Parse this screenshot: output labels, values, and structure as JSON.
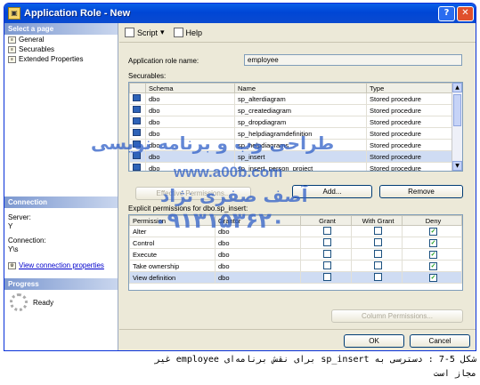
{
  "window": {
    "title": "Application Role - New"
  },
  "left": {
    "select_page_header": "Select a page",
    "pages": [
      {
        "label": "General"
      },
      {
        "label": "Securables"
      },
      {
        "label": "Extended Properties"
      }
    ],
    "connection_header": "Connection",
    "server_label": "Server:",
    "server_value": "Y",
    "connection_label": "Connection:",
    "connection_value": "Y\\s",
    "view_conn_link": "View connection properties",
    "progress_header": "Progress",
    "progress_status": "Ready"
  },
  "toolbar": {
    "script_label": "Script",
    "help_label": "Help"
  },
  "form": {
    "role_name_label": "Application role name:",
    "role_name_value": "employee",
    "securables_label": "Securables:",
    "securables_columns": [
      "",
      "Schema",
      "Name",
      "Type"
    ],
    "securables_rows": [
      {
        "schema": "dbo",
        "name": "sp_alterdiagram",
        "type": "Stored procedure"
      },
      {
        "schema": "dbo",
        "name": "sp_creatediagram",
        "type": "Stored procedure"
      },
      {
        "schema": "dbo",
        "name": "sp_dropdiagram",
        "type": "Stored procedure"
      },
      {
        "schema": "dbo",
        "name": "sp_helpdiagramdefinition",
        "type": "Stored procedure"
      },
      {
        "schema": "dbo",
        "name": "sp_helpdiagrams",
        "type": "Stored procedure"
      },
      {
        "schema": "dbo",
        "name": "sp_insert",
        "type": "Stored procedure"
      },
      {
        "schema": "dbo",
        "name": "sp_insert_person_project",
        "type": "Stored procedure"
      }
    ],
    "effective_permissions_btn": "Effective Permissions...",
    "add_btn": "Add...",
    "remove_btn": "Remove",
    "explicit_label": "Explicit permissions for dbo.sp_insert:",
    "perm_columns": [
      "Permission",
      "Grantor",
      "Grant",
      "With Grant",
      "Deny"
    ],
    "perm_rows": [
      {
        "permission": "Alter",
        "grantor": "dbo",
        "grant": false,
        "with_grant": false,
        "deny": true
      },
      {
        "permission": "Control",
        "grantor": "dbo",
        "grant": false,
        "with_grant": false,
        "deny": true
      },
      {
        "permission": "Execute",
        "grantor": "dbo",
        "grant": false,
        "with_grant": false,
        "deny": true
      },
      {
        "permission": "Take ownership",
        "grantor": "dbo",
        "grant": false,
        "with_grant": false,
        "deny": true
      },
      {
        "permission": "View definition",
        "grantor": "dbo",
        "grant": false,
        "with_grant": false,
        "deny": true
      }
    ],
    "column_permissions_btn": "Column Permissions...",
    "ok_btn": "OK",
    "cancel_btn": "Cancel"
  },
  "watermark": {
    "line1": "طراحی وب و برنامه نویسی",
    "line2": "www.a00b.com",
    "line3": "آصف صفری نژاد",
    "line4": "۰۹۱۳۱۵۳۶۲۰"
  },
  "caption": {
    "line1": "شکل 5-7 : دسترسی به sp_insert برای نقش برنامه‌ای employee غیر",
    "line2": "مجاز است"
  }
}
